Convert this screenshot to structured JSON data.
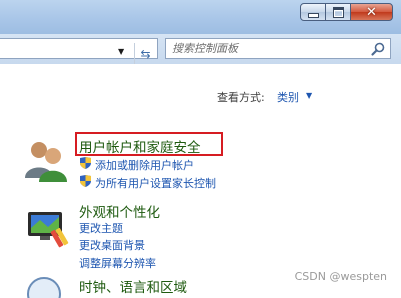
{
  "search": {
    "placeholder": "搜索控制面板"
  },
  "view_by": {
    "label": "查看方式:",
    "value": "类别"
  },
  "categories": [
    {
      "title": "用户帐户和家庭安全",
      "links": [
        "添加或删除用户帐户",
        "为所有用户设置家长控制"
      ]
    },
    {
      "title": "外观和个性化",
      "links": [
        "更改主题",
        "更改桌面背景",
        "调整屏幕分辨率"
      ]
    },
    {
      "title": "时钟、语言和区域",
      "links": []
    }
  ],
  "watermark": "CSDN @wespten",
  "colors": {
    "highlight": "#d61c22",
    "link": "#1e56b0",
    "category": "#1e5a0f"
  }
}
